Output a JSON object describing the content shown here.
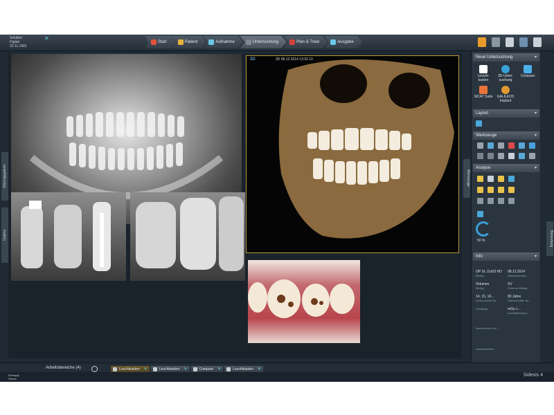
{
  "brand": {
    "line1": "Solution",
    "line2": "Digital",
    "line3": "22.11.1981"
  },
  "nav_tabs": [
    {
      "label": "Start",
      "icon": "home-icon",
      "color": "#e0543c"
    },
    {
      "label": "Patient",
      "icon": "patient-icon",
      "color": "#e7b43c"
    },
    {
      "label": "Aufnahme",
      "icon": "acquisition-icon",
      "color": "#6cc6e8"
    },
    {
      "label": "Untersuchung",
      "icon": "examination-icon",
      "color": "#7f8a95"
    },
    {
      "label": "Plan & Treat",
      "icon": "plan-treat-icon",
      "color": "#d0463c"
    },
    {
      "label": "Ausgabe",
      "icon": "output-icon",
      "color": "#6cc6e8"
    }
  ],
  "viewer": {
    "pano_side_label": "L",
    "ct_label": "3D",
    "ct_datetime": "3D 08.12.2014 13:32:13"
  },
  "left_strip": {
    "top": "Sitzungsgalerie",
    "bottom": "Galerie"
  },
  "sidebar": {
    "section_new": "Neue Untersuchung",
    "new_items": [
      {
        "label": "Leucht-kasten",
        "icon": "lightbox-icon"
      },
      {
        "label": "3D-Unter-suchung",
        "icon": "3d-examination-icon"
      },
      {
        "label": "Compare",
        "icon": "compare-icon"
      },
      {
        "label": "SICAT Suite",
        "icon": "sicat-suite-icon"
      },
      {
        "label": "GALILEOS Implant",
        "icon": "galileos-implant-icon"
      }
    ],
    "section_layout": "Layout",
    "section_tools": "Werkzeuge",
    "section_analysis": "Analyse",
    "zoom_value": "50 %",
    "section_info": "Info",
    "info": [
      {
        "value": "OP SL 11x03 HD",
        "label": "Bildtyp"
      },
      {
        "value": "08.12.2014",
        "label": "Aufnahmedatu..."
      },
      {
        "value": "Volumen",
        "label": "Bildtyp"
      },
      {
        "value": "XV",
        "label": "Externes Bildtyp"
      },
      {
        "value": "14, 15, 16...",
        "label": "Anatomische Re..."
      },
      {
        "value": "83 Jahre",
        "label": "Patientenalter be..."
      },
      {
        "value": "",
        "label": "Gerätetyp"
      },
      {
        "value": "mGy·c...",
        "label": "Dosisflächenpro..."
      },
      {
        "value": "",
        "label": "Nachfolender Be..."
      },
      {
        "value": "",
        "label": "Aufnahmeleiter"
      }
    ]
  },
  "right_tabs": {
    "tools": "Werkzeuge",
    "notes": "Befundung"
  },
  "workspace": {
    "label": "Arbeitsbereiche (4)",
    "tabs": [
      {
        "label": "Leuchtkasten",
        "active": true
      },
      {
        "label": "Leuchtkasten",
        "active": false
      },
      {
        "label": "Compare",
        "active": false
      },
      {
        "label": "Leuchtkasten",
        "active": false
      }
    ]
  },
  "footer": {
    "logo_line1": "Dentsply",
    "logo_line2": "Sirona",
    "product": "Sidexis 4"
  }
}
